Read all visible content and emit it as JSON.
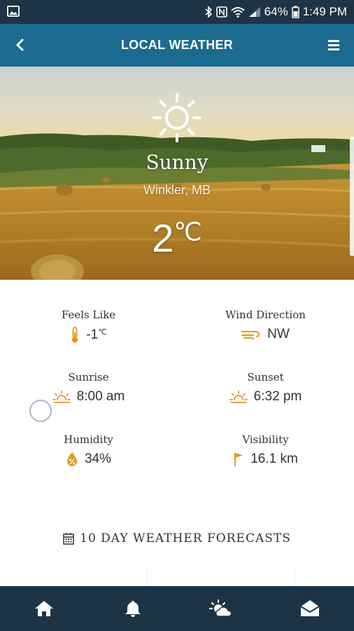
{
  "status_bar": {
    "battery": "64%",
    "time": "1:49 PM"
  },
  "app_bar": {
    "title": "LOCAL WEATHER"
  },
  "current": {
    "condition": "Sunny",
    "location": "Winkler, MB",
    "temperature": "2",
    "temperature_unit": "℃"
  },
  "details": {
    "feels_like": {
      "label": "Feels Like",
      "value": "-1",
      "unit": "℃",
      "icon": "thermometer-icon"
    },
    "wind_direction": {
      "label": "Wind Direction",
      "value": "NW",
      "icon": "wind-icon"
    },
    "sunrise": {
      "label": "Sunrise",
      "value": "8:00 am",
      "icon": "sunrise-icon"
    },
    "sunset": {
      "label": "Sunset",
      "value": "6:32 pm",
      "icon": "sunset-icon"
    },
    "humidity": {
      "label": "Humidity",
      "value": "34%",
      "icon": "humidity-icon"
    },
    "visibility": {
      "label": "Visibility",
      "value": "16.1 km",
      "icon": "flag-icon"
    }
  },
  "forecast": {
    "title": "10 DAY WEATHER FORECASTS"
  },
  "bottom_nav": [
    "home-icon",
    "bell-icon",
    "weather-icon",
    "mail-icon"
  ],
  "colors": {
    "app_bar": "#1b6a8f",
    "status_bar": "#1c3446",
    "bottom_nav": "#1c3446",
    "accent_icon": "#e8961e"
  }
}
